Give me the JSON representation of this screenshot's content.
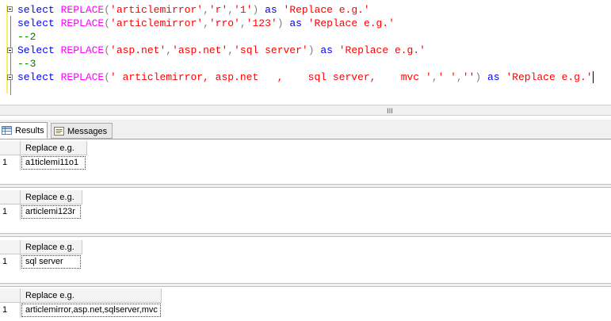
{
  "editor": {
    "lines": [
      [
        {
          "t": "select ",
          "c": "kw"
        },
        {
          "t": "REPLACE",
          "c": "fn"
        },
        {
          "t": "(",
          "c": "pun"
        },
        {
          "t": "'articlemirror'",
          "c": "str"
        },
        {
          "t": ",",
          "c": "pun"
        },
        {
          "t": "'r'",
          "c": "str"
        },
        {
          "t": ",",
          "c": "pun"
        },
        {
          "t": "'1'",
          "c": "str"
        },
        {
          "t": ") ",
          "c": "pun"
        },
        {
          "t": "as ",
          "c": "kw"
        },
        {
          "t": "'Replace e.g.'",
          "c": "str"
        }
      ],
      [
        {
          "t": "select ",
          "c": "kw"
        },
        {
          "t": "REPLACE",
          "c": "fn"
        },
        {
          "t": "(",
          "c": "pun"
        },
        {
          "t": "'articlemirror'",
          "c": "str"
        },
        {
          "t": ",",
          "c": "pun"
        },
        {
          "t": "'rro'",
          "c": "str"
        },
        {
          "t": ",",
          "c": "pun"
        },
        {
          "t": "'123'",
          "c": "str"
        },
        {
          "t": ") ",
          "c": "pun"
        },
        {
          "t": "as ",
          "c": "kw"
        },
        {
          "t": "'Replace e.g.'",
          "c": "str"
        }
      ],
      [
        {
          "t": "--2",
          "c": "cm"
        }
      ],
      [
        {
          "t": "Select ",
          "c": "kw"
        },
        {
          "t": "REPLACE",
          "c": "fn"
        },
        {
          "t": "(",
          "c": "pun"
        },
        {
          "t": "'asp.net'",
          "c": "str"
        },
        {
          "t": ",",
          "c": "pun"
        },
        {
          "t": "'asp.net'",
          "c": "str"
        },
        {
          "t": ",",
          "c": "pun"
        },
        {
          "t": "'sql server'",
          "c": "str"
        },
        {
          "t": ") ",
          "c": "pun"
        },
        {
          "t": "as ",
          "c": "kw"
        },
        {
          "t": "'Replace e.g.'",
          "c": "str"
        }
      ],
      [
        {
          "t": "--3",
          "c": "cm"
        }
      ],
      [
        {
          "t": "select ",
          "c": "kw"
        },
        {
          "t": "REPLACE",
          "c": "fn"
        },
        {
          "t": "(",
          "c": "pun"
        },
        {
          "t": "' articlemirror, asp.net   ,    sql server,    mvc '",
          "c": "str"
        },
        {
          "t": ",",
          "c": "pun"
        },
        {
          "t": "' '",
          "c": "str"
        },
        {
          "t": ",",
          "c": "pun"
        },
        {
          "t": "''",
          "c": "str"
        },
        {
          "t": ") ",
          "c": "pun"
        },
        {
          "t": "as ",
          "c": "kw"
        },
        {
          "t": "'Replace e.g.'",
          "c": "str"
        }
      ]
    ]
  },
  "scroll": {
    "grip": "III"
  },
  "tabs": {
    "results": "Results",
    "messages": "Messages"
  },
  "grids": [
    {
      "header": "Replace e.g.",
      "rownum": "1",
      "value": "a1ticlemi11o1"
    },
    {
      "header": "Replace e.g.",
      "rownum": "1",
      "value": "articlemi123r"
    },
    {
      "header": "Replace e.g.",
      "rownum": "1",
      "value": "sql server"
    },
    {
      "header": "Replace e.g.",
      "rownum": "1",
      "value": "articlemirror,asp.net,sqlserver,mvc"
    }
  ]
}
